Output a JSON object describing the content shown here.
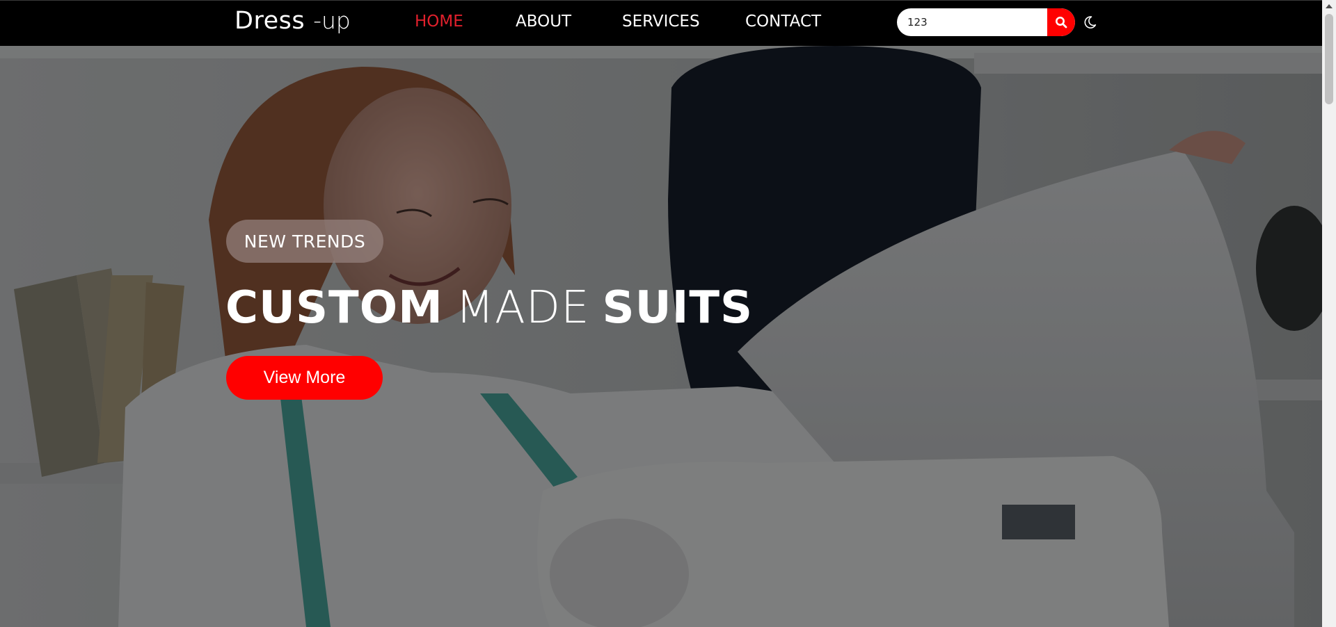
{
  "navbar": {
    "logo": {
      "main": "Dress",
      "sub": "-up"
    },
    "links": [
      {
        "label": "HOME",
        "active": true
      },
      {
        "label": "ABOUT",
        "active": false
      },
      {
        "label": "SERVICES",
        "active": false
      },
      {
        "label": "CONTACT",
        "active": false
      }
    ],
    "search": {
      "value": "123",
      "icon": "search-icon"
    },
    "theme_toggle_icon": "moon-icon"
  },
  "hero": {
    "badge": "NEW TRENDS",
    "headline": {
      "word1": "CUSTOM",
      "word2": "MADE",
      "word3": "SUITS"
    },
    "cta_label": "View More",
    "background": "photo-seamstress-at-sewing-machine"
  },
  "colors": {
    "accent": "#ff0000",
    "active_link": "#e0202c",
    "navbar_bg": "#000000",
    "text": "#ffffff"
  }
}
